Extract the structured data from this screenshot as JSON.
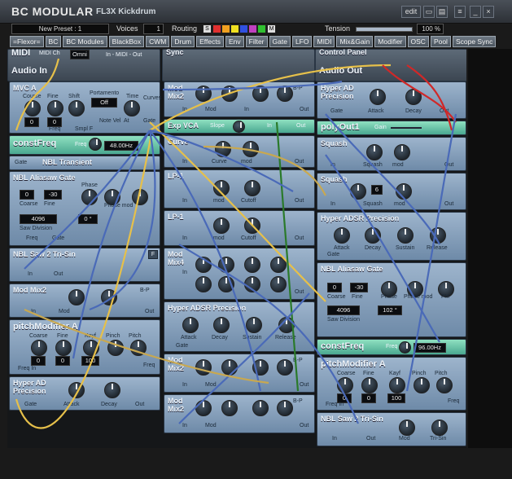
{
  "app": {
    "title": "BC MODULAR",
    "subtitle": "FL3X Kickdrum",
    "edit_label": "edit"
  },
  "preset": {
    "name": "New Preset : 1"
  },
  "voices": {
    "label": "Voices",
    "value": "1"
  },
  "routing": {
    "label": "Routing",
    "s": "S",
    "m": "M",
    "colors": [
      "#e03030",
      "#f0a020",
      "#f0e020",
      "#3050e0",
      "#c040c0",
      "#30c030"
    ]
  },
  "tension": {
    "label": "Tension",
    "value": "100 %",
    "level_percent": 100
  },
  "tabs": [
    "=Flexor=",
    "BC",
    "BC Modules",
    "BlackBox",
    "CWM",
    "Drum",
    "Effects",
    "Env",
    "Filter",
    "Gate",
    "LFO",
    "MIDI",
    "Mix&Gain",
    "Modifier",
    "OSC",
    "Pool",
    "Scope Sync"
  ],
  "header_strip": {
    "midi": "MIDI",
    "midi_ch": "MIDI Ch",
    "omni": "Omni",
    "midi_out": "In - MIDI - Out",
    "sync": "Sync",
    "control_panel": "Control Panel",
    "audio_in": "Audio In",
    "audio_out": "Audio Out",
    "port_numbers": [
      "01",
      "02",
      "03",
      "04",
      "05",
      "06",
      "07",
      "08",
      "09",
      "10",
      "11",
      "12",
      "13",
      "14",
      "15",
      "16"
    ]
  },
  "modules": {
    "mvc_a": {
      "title": "MVC A",
      "coarse": "Course",
      "fine": "Fine",
      "shift": "Shift",
      "portamento": "Portamento",
      "port_state": "Off",
      "time": "Time",
      "curves": "Curves",
      "coarse_val": "0",
      "fine_val": "0",
      "note_vel": "Note Vel",
      "at": "At",
      "gate": "Gate",
      "freq": "Freq",
      "smpl_f": "Smpl F"
    },
    "constfreq_a": {
      "title": "constFreq",
      "freq_label": "Freq",
      "value": "48.00Hz"
    },
    "nbl_transient": {
      "title": "NBL Transient",
      "gate": "Gate"
    },
    "nbl_aliasaw": {
      "title": "NBL Aliasaw Gate",
      "coarse": "Coarse",
      "fine": "Fine",
      "phase": "Phase",
      "phase_mod": "Phase mod",
      "coarse_val": "0",
      "fine_val": "-30",
      "div_val": "4096",
      "phase_val": "0 °",
      "saw_division": "Saw Division",
      "freq": "Freq",
      "gate": "Gate"
    },
    "nbl_saw2_a": {
      "title": "NBL Saw 2 Tri-Sin",
      "in": "In",
      "out": "Out",
      "f": "F"
    },
    "mod_mix2_a": {
      "title": "Mod Mix2",
      "in": "In",
      "mod": "Mod",
      "out": "Out",
      "bp": "B-P"
    },
    "pitchmod_a": {
      "title": "pitchModifier A",
      "coarse": "Coarse",
      "fine": "Fine",
      "kayf": "Kayf",
      "pinch": "Pinch",
      "pitch": "Pitch",
      "coarse_val": "0",
      "fine_val": "0",
      "kayf_val": "100",
      "freq_in": "Freq In",
      "freq": "Freq"
    },
    "hyper_ad_a": {
      "title": "Hyper AD Precision",
      "gate": "Gate",
      "attack": "Attack",
      "decay": "Decay",
      "out": "Out"
    },
    "mod_mix2_b": {
      "title": "Mod Mix2",
      "in": "In",
      "mod": "Mod",
      "out": "Out",
      "bp": "B-P"
    },
    "exp_vca": {
      "title": "Exp VCA",
      "slope": "Slope",
      "in": "In",
      "out": "Out"
    },
    "curve": {
      "title": "Curve",
      "in": "In",
      "curve": "Curve",
      "mod": "mod",
      "out": "Out"
    },
    "lp1_a": {
      "title": "LP-1",
      "in": "In",
      "mod": "mod",
      "cutoff": "Cutoff",
      "out": "Out"
    },
    "lp1_b": {
      "title": "LP-1",
      "in": "In",
      "mod": "mod",
      "cutoff": "Cutoff",
      "out": "Out"
    },
    "mod_mix4": {
      "title": "Mod Mix4",
      "in": "In",
      "mod": "Mod",
      "out": "Out"
    },
    "hyper_adsr_a": {
      "title": "Hyper ADSR Precision",
      "gate": "Gate",
      "attack": "Attack",
      "decay": "Decay",
      "sustain": "Sustain",
      "release": "Release"
    },
    "mod_mix2_c": {
      "title": "Mod Mix2",
      "in": "In",
      "mod": "Mod",
      "out": "Out",
      "bp": "B-P"
    },
    "mod_mix2_d": {
      "title": "Mod Mix2",
      "in": "In",
      "mod": "Mod",
      "out": "Out",
      "bp": "B-P"
    },
    "hyper_ad_b": {
      "title": "Hyper AD Precision",
      "gate": "Gate",
      "attack": "Attack",
      "decay": "Decay",
      "out": "Out"
    },
    "polyout1": {
      "title": "polyOut1",
      "gain": "Gain"
    },
    "squash_a": {
      "title": "Squash",
      "in": "In",
      "squash": "Squash",
      "mod": "mod",
      "out": "Out"
    },
    "squash_b": {
      "title": "Squash",
      "in": "In",
      "value": "6",
      "squash": "Squash",
      "mod": "mod",
      "out": "Out"
    },
    "hyper_adsr_b": {
      "title": "Hyper ADSR Precision",
      "gate": "Gate",
      "attack": "Attack",
      "decay": "Decay",
      "sustain": "Sustain",
      "release": "Release"
    },
    "nbl_aliasaw_b": {
      "title": "NBL Aliasaw Gate",
      "coarse_val": "0",
      "fine_val": "-30",
      "div_val": "4096",
      "phase_val": "102 °",
      "coarse": "Coarse",
      "fine": "Fine",
      "phase": "Phase",
      "phase_mod": "Phase mod",
      "saw_division": "Saw Division",
      "fm": "FM"
    },
    "constfreq_b": {
      "title": "constFreq",
      "freq_label": "Freq",
      "value": "96.00Hz"
    },
    "pitchmod_b": {
      "title": "pitchModifier A",
      "coarse": "Coarse",
      "fine": "Fine",
      "kayf": "Kayf",
      "pinch": "Pinch",
      "pitch": "Pitch",
      "coarse_val": "0",
      "fine_val": "0",
      "kayf_val": "100",
      "freq_in": "Freq In",
      "freq": "Freq"
    },
    "nbl_saw2_b": {
      "title": "NBL Saw 2 Tri-Sin",
      "in": "In",
      "mod": "Mod",
      "out": "Out",
      "tri_sin": "Tri-Sin"
    }
  }
}
